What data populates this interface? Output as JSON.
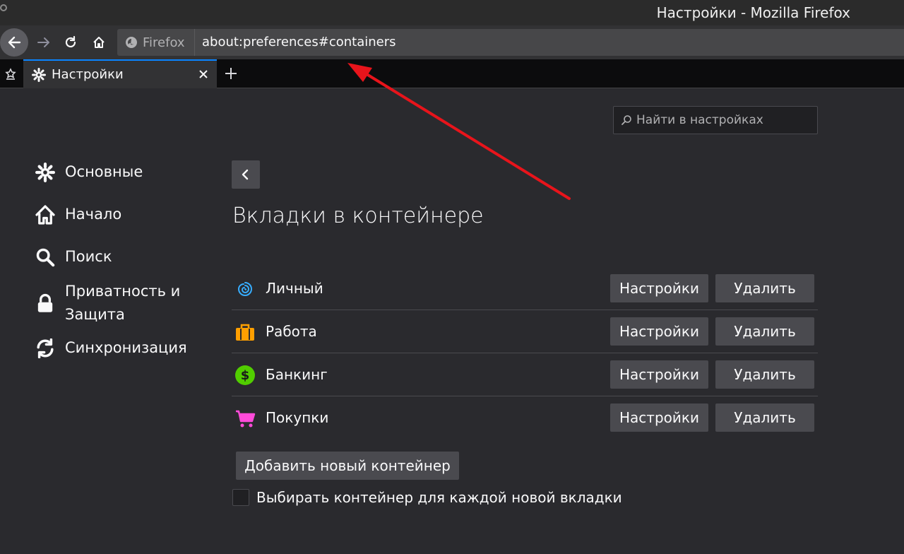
{
  "window": {
    "title": "Настройки - Mozilla Firefox"
  },
  "navbar": {
    "identity_label": "Firefox",
    "url": "about:preferences#containers",
    "icons": [
      "back-icon",
      "forward-icon",
      "reload-icon",
      "home-icon",
      "firefox-icon"
    ]
  },
  "tabbar": {
    "tab_title": "Настройки",
    "icons": [
      "pinned-icon",
      "gear-icon",
      "close-icon",
      "plus-icon"
    ]
  },
  "search": {
    "placeholder": "Найти в настройках"
  },
  "sidebar": {
    "items": [
      {
        "label": "Основные",
        "icon": "gear-icon"
      },
      {
        "label": "Начало",
        "icon": "home-icon"
      },
      {
        "label": "Поиск",
        "icon": "search-icon"
      },
      {
        "label": "Приватность и Защита",
        "icon": "lock-icon"
      },
      {
        "label": "Синхронизация",
        "icon": "sync-icon"
      }
    ]
  },
  "main": {
    "heading": "Вкладки в контейнере",
    "containers": [
      {
        "name": "Личный",
        "icon": "fingerprint-icon",
        "color": "#37adff",
        "prefs_label": "Настройки",
        "remove_label": "Удалить"
      },
      {
        "name": "Работа",
        "icon": "briefcase-icon",
        "color": "#ff9f00",
        "prefs_label": "Настройки",
        "remove_label": "Удалить"
      },
      {
        "name": "Банкинг",
        "icon": "dollar-icon",
        "color": "#51cd00",
        "prefs_label": "Настройки",
        "remove_label": "Удалить"
      },
      {
        "name": "Покупки",
        "icon": "cart-icon",
        "color": "#ff4bda",
        "prefs_label": "Настройки",
        "remove_label": "Удалить"
      }
    ],
    "add_button": "Добавить новый контейнер",
    "always_ask_label": "Выбирать контейнер для каждой новой вкладки",
    "always_ask_checked": false
  },
  "colors": {
    "accent": "#0a84ff",
    "annotation_arrow": "#e8141b"
  }
}
